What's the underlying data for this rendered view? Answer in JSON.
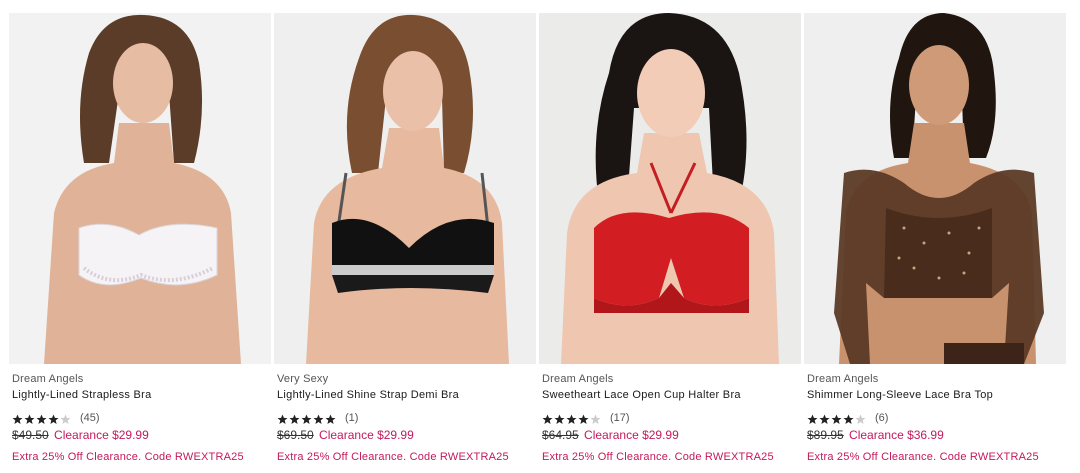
{
  "products": [
    {
      "brand": "Dream Angels",
      "name": "Lightly-Lined Strapless Bra",
      "rating": 4,
      "review_count": "(45)",
      "original_price": "$49.50",
      "sale_price": "Clearance $29.99",
      "promo": "Extra 25% Off Clearance. Code RWEXTRA25",
      "image_description_colors": {
        "bg": "#f2f2f2",
        "garment": "#f4f1f4",
        "skin": "#e0b398",
        "hair": "#5a3c28"
      }
    },
    {
      "brand": "Very Sexy",
      "name": "Lightly-Lined Shine Strap Demi Bra",
      "rating": 5,
      "review_count": "(1)",
      "original_price": "$69.50",
      "sale_price": "Clearance $29.99",
      "promo": "Extra 25% Off Clearance. Code RWEXTRA25",
      "image_description_colors": {
        "bg": "#efefef",
        "garment": "#111111",
        "skin": "#e7b99f",
        "hair": "#7a4e30"
      }
    },
    {
      "brand": "Dream Angels",
      "name": "Sweetheart Lace Open Cup Halter Bra",
      "rating": 4,
      "review_count": "(17)",
      "original_price": "$64.95",
      "sale_price": "Clearance $29.99",
      "promo": "Extra 25% Off Clearance. Code RWEXTRA25",
      "image_description_colors": {
        "bg": "#ebebea",
        "garment": "#d21e22",
        "skin": "#efc6b0",
        "hair": "#1a1412"
      }
    },
    {
      "brand": "Dream Angels",
      "name": "Shimmer Long-Sleeve Lace Bra Top",
      "rating": 4,
      "review_count": "(6)",
      "original_price": "$89.95",
      "sale_price": "Clearance $36.99",
      "promo": "Extra 25% Off Clearance. Code RWEXTRA25",
      "image_description_colors": {
        "bg": "#efefef",
        "garment": "#5b3a26",
        "skin": "#c9926f",
        "hair": "#20150f"
      }
    }
  ],
  "colors": {
    "accent": "#c4195a",
    "star": "#222222",
    "star_empty": "#cccccc"
  }
}
